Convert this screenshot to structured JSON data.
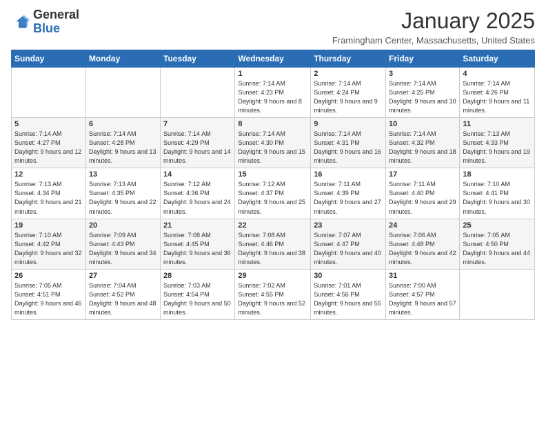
{
  "header": {
    "logo_general": "General",
    "logo_blue": "Blue",
    "month_title": "January 2025",
    "location": "Framingham Center, Massachusetts, United States"
  },
  "days_of_week": [
    "Sunday",
    "Monday",
    "Tuesday",
    "Wednesday",
    "Thursday",
    "Friday",
    "Saturday"
  ],
  "weeks": [
    [
      null,
      null,
      null,
      {
        "day": 1,
        "sunrise": "7:14 AM",
        "sunset": "4:23 PM",
        "daylight": "9 hours and 8 minutes."
      },
      {
        "day": 2,
        "sunrise": "7:14 AM",
        "sunset": "4:24 PM",
        "daylight": "9 hours and 9 minutes."
      },
      {
        "day": 3,
        "sunrise": "7:14 AM",
        "sunset": "4:25 PM",
        "daylight": "9 hours and 10 minutes."
      },
      {
        "day": 4,
        "sunrise": "7:14 AM",
        "sunset": "4:26 PM",
        "daylight": "9 hours and 11 minutes."
      }
    ],
    [
      {
        "day": 5,
        "sunrise": "7:14 AM",
        "sunset": "4:27 PM",
        "daylight": "9 hours and 12 minutes."
      },
      {
        "day": 6,
        "sunrise": "7:14 AM",
        "sunset": "4:28 PM",
        "daylight": "9 hours and 13 minutes."
      },
      {
        "day": 7,
        "sunrise": "7:14 AM",
        "sunset": "4:29 PM",
        "daylight": "9 hours and 14 minutes."
      },
      {
        "day": 8,
        "sunrise": "7:14 AM",
        "sunset": "4:30 PM",
        "daylight": "9 hours and 15 minutes."
      },
      {
        "day": 9,
        "sunrise": "7:14 AM",
        "sunset": "4:31 PM",
        "daylight": "9 hours and 16 minutes."
      },
      {
        "day": 10,
        "sunrise": "7:14 AM",
        "sunset": "4:32 PM",
        "daylight": "9 hours and 18 minutes."
      },
      {
        "day": 11,
        "sunrise": "7:13 AM",
        "sunset": "4:33 PM",
        "daylight": "9 hours and 19 minutes."
      }
    ],
    [
      {
        "day": 12,
        "sunrise": "7:13 AM",
        "sunset": "4:34 PM",
        "daylight": "9 hours and 21 minutes."
      },
      {
        "day": 13,
        "sunrise": "7:13 AM",
        "sunset": "4:35 PM",
        "daylight": "9 hours and 22 minutes."
      },
      {
        "day": 14,
        "sunrise": "7:12 AM",
        "sunset": "4:36 PM",
        "daylight": "9 hours and 24 minutes."
      },
      {
        "day": 15,
        "sunrise": "7:12 AM",
        "sunset": "4:37 PM",
        "daylight": "9 hours and 25 minutes."
      },
      {
        "day": 16,
        "sunrise": "7:11 AM",
        "sunset": "4:39 PM",
        "daylight": "9 hours and 27 minutes."
      },
      {
        "day": 17,
        "sunrise": "7:11 AM",
        "sunset": "4:40 PM",
        "daylight": "9 hours and 29 minutes."
      },
      {
        "day": 18,
        "sunrise": "7:10 AM",
        "sunset": "4:41 PM",
        "daylight": "9 hours and 30 minutes."
      }
    ],
    [
      {
        "day": 19,
        "sunrise": "7:10 AM",
        "sunset": "4:42 PM",
        "daylight": "9 hours and 32 minutes."
      },
      {
        "day": 20,
        "sunrise": "7:09 AM",
        "sunset": "4:43 PM",
        "daylight": "9 hours and 34 minutes."
      },
      {
        "day": 21,
        "sunrise": "7:08 AM",
        "sunset": "4:45 PM",
        "daylight": "9 hours and 36 minutes."
      },
      {
        "day": 22,
        "sunrise": "7:08 AM",
        "sunset": "4:46 PM",
        "daylight": "9 hours and 38 minutes."
      },
      {
        "day": 23,
        "sunrise": "7:07 AM",
        "sunset": "4:47 PM",
        "daylight": "9 hours and 40 minutes."
      },
      {
        "day": 24,
        "sunrise": "7:06 AM",
        "sunset": "4:48 PM",
        "daylight": "9 hours and 42 minutes."
      },
      {
        "day": 25,
        "sunrise": "7:05 AM",
        "sunset": "4:50 PM",
        "daylight": "9 hours and 44 minutes."
      }
    ],
    [
      {
        "day": 26,
        "sunrise": "7:05 AM",
        "sunset": "4:51 PM",
        "daylight": "9 hours and 46 minutes."
      },
      {
        "day": 27,
        "sunrise": "7:04 AM",
        "sunset": "4:52 PM",
        "daylight": "9 hours and 48 minutes."
      },
      {
        "day": 28,
        "sunrise": "7:03 AM",
        "sunset": "4:54 PM",
        "daylight": "9 hours and 50 minutes."
      },
      {
        "day": 29,
        "sunrise": "7:02 AM",
        "sunset": "4:55 PM",
        "daylight": "9 hours and 52 minutes."
      },
      {
        "day": 30,
        "sunrise": "7:01 AM",
        "sunset": "4:56 PM",
        "daylight": "9 hours and 55 minutes."
      },
      {
        "day": 31,
        "sunrise": "7:00 AM",
        "sunset": "4:57 PM",
        "daylight": "9 hours and 57 minutes."
      },
      null
    ]
  ]
}
